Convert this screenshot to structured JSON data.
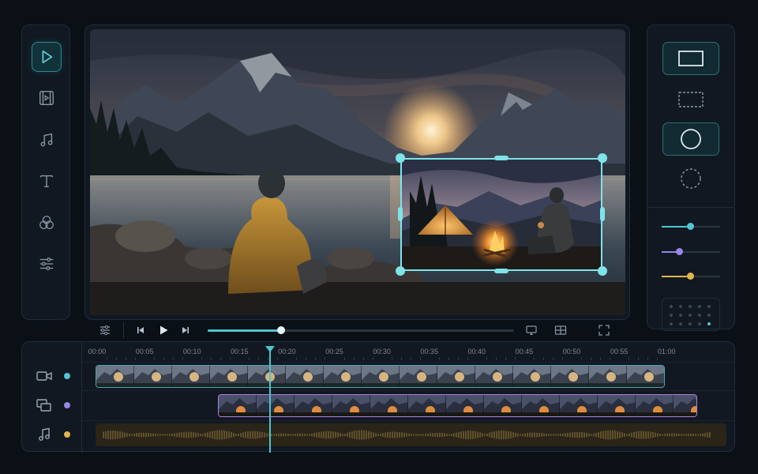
{
  "left_toolbar": {
    "tools": [
      {
        "icon": "play-icon",
        "active": true
      },
      {
        "icon": "film-icon",
        "active": false
      },
      {
        "icon": "music-note-icon",
        "active": false
      },
      {
        "icon": "text-icon",
        "active": false
      },
      {
        "icon": "color-circles-icon",
        "active": false
      },
      {
        "icon": "adjust-sliders-icon",
        "active": false
      }
    ]
  },
  "player": {
    "progress": 0.24,
    "controls": [
      "settings-sliders-icon",
      "skip-back-icon",
      "play-icon",
      "skip-forward-icon",
      "cast-icon",
      "layout-grid-icon",
      "fullscreen-icon"
    ]
  },
  "shapes_panel": {
    "shapes": [
      {
        "icon": "rectangle-icon",
        "active": true
      },
      {
        "icon": "dashed-rectangle-icon",
        "active": false
      },
      {
        "icon": "circle-icon",
        "active": true
      },
      {
        "icon": "dashed-circle-icon",
        "active": false
      }
    ],
    "sliders": [
      {
        "color": "#4fc6d0",
        "value": 0.48
      },
      {
        "color": "#9a86e8",
        "value": 0.3
      },
      {
        "color": "#e0b44c",
        "value": 0.48
      }
    ]
  },
  "timeline": {
    "ruler": [
      "00:00",
      "00:05",
      "00:10",
      "00:15",
      "00:20",
      "00:25",
      "00:30",
      "00:35",
      "00:40",
      "00:45",
      "00:50",
      "00:55",
      "01:00"
    ],
    "playhead_time": "00:19",
    "tracks": [
      {
        "icon": "video-camera-icon",
        "color": "#4fc6d0"
      },
      {
        "icon": "overlay-layers-icon",
        "color": "#9a86e8"
      },
      {
        "icon": "music-note-icon",
        "color": "#e0b44c"
      }
    ]
  },
  "colors": {
    "accent": "#49c5cf",
    "overlay_track": "#b07fe0",
    "audio_track": "#e0b44c",
    "background": "#0b1017"
  }
}
